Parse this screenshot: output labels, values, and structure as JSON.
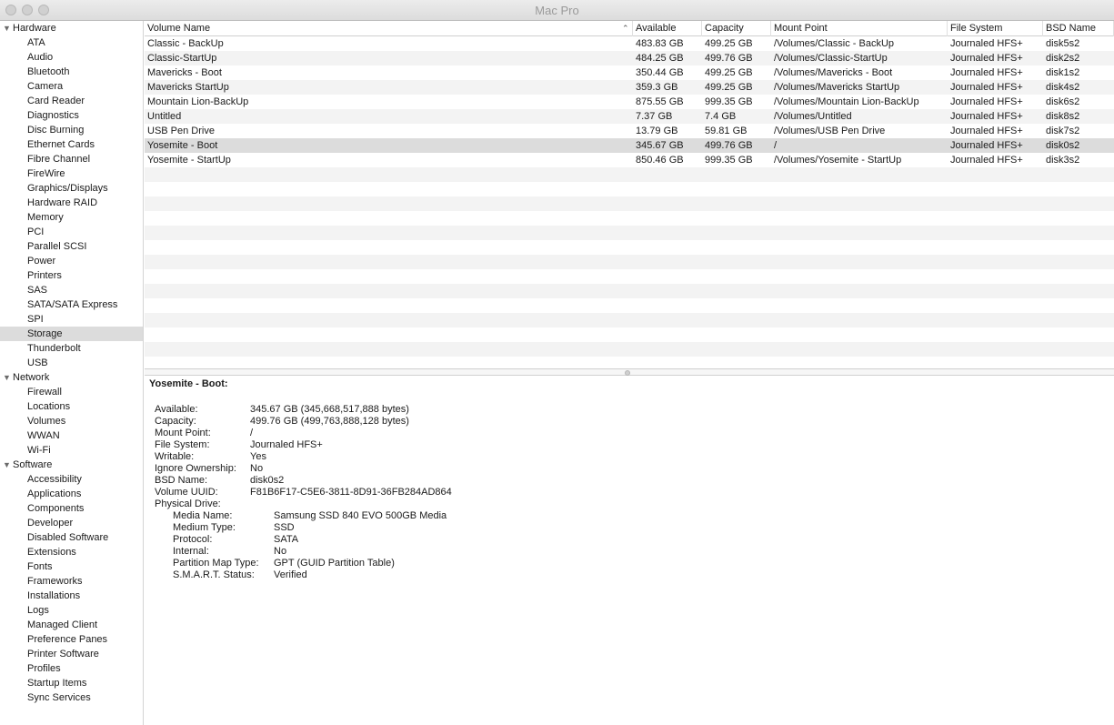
{
  "window": {
    "title": "Mac Pro"
  },
  "sidebar": {
    "groups": [
      {
        "label": "Hardware",
        "items": [
          "ATA",
          "Audio",
          "Bluetooth",
          "Camera",
          "Card Reader",
          "Diagnostics",
          "Disc Burning",
          "Ethernet Cards",
          "Fibre Channel",
          "FireWire",
          "Graphics/Displays",
          "Hardware RAID",
          "Memory",
          "PCI",
          "Parallel SCSI",
          "Power",
          "Printers",
          "SAS",
          "SATA/SATA Express",
          "SPI",
          "Storage",
          "Thunderbolt",
          "USB"
        ]
      },
      {
        "label": "Network",
        "items": [
          "Firewall",
          "Locations",
          "Volumes",
          "WWAN",
          "Wi-Fi"
        ]
      },
      {
        "label": "Software",
        "items": [
          "Accessibility",
          "Applications",
          "Components",
          "Developer",
          "Disabled Software",
          "Extensions",
          "Fonts",
          "Frameworks",
          "Installations",
          "Logs",
          "Managed Client",
          "Preference Panes",
          "Printer Software",
          "Profiles",
          "Startup Items",
          "Sync Services"
        ]
      }
    ],
    "selected": "Storage"
  },
  "table": {
    "columns": [
      "Volume Name",
      "Available",
      "Capacity",
      "Mount Point",
      "File System",
      "BSD Name"
    ],
    "rows": [
      [
        "Classic - BackUp",
        "483.83 GB",
        "499.25 GB",
        "/Volumes/Classic - BackUp",
        "Journaled HFS+",
        "disk5s2"
      ],
      [
        "Classic-StartUp",
        "484.25 GB",
        "499.76 GB",
        "/Volumes/Classic-StartUp",
        "Journaled HFS+",
        "disk2s2"
      ],
      [
        "Mavericks - Boot",
        "350.44 GB",
        "499.25 GB",
        "/Volumes/Mavericks - Boot",
        "Journaled HFS+",
        "disk1s2"
      ],
      [
        "Mavericks StartUp",
        "359.3 GB",
        "499.25 GB",
        "/Volumes/Mavericks StartUp",
        "Journaled HFS+",
        "disk4s2"
      ],
      [
        "Mountain Lion-BackUp",
        "875.55 GB",
        "999.35 GB",
        "/Volumes/Mountain Lion-BackUp",
        "Journaled HFS+",
        "disk6s2"
      ],
      [
        "Untitled",
        "7.37 GB",
        "7.4 GB",
        "/Volumes/Untitled",
        "Journaled HFS+",
        "disk8s2"
      ],
      [
        "USB Pen Drive",
        "13.79 GB",
        "59.81 GB",
        "/Volumes/USB Pen Drive",
        "Journaled HFS+",
        "disk7s2"
      ],
      [
        "Yosemite - Boot",
        "345.67 GB",
        "499.76 GB",
        "/",
        "Journaled HFS+",
        "disk0s2"
      ],
      [
        "Yosemite - StartUp",
        "850.46 GB",
        "999.35 GB",
        "/Volumes/Yosemite - StartUp",
        "Journaled HFS+",
        "disk3s2"
      ]
    ],
    "selected_row": 7,
    "sort_icon": "chevron-up-icon"
  },
  "detail": {
    "title": "Yosemite - Boot:",
    "fields": [
      {
        "k": "Available:",
        "v": "345.67 GB (345,668,517,888 bytes)"
      },
      {
        "k": "Capacity:",
        "v": "499.76 GB (499,763,888,128 bytes)"
      },
      {
        "k": "Mount Point:",
        "v": "/"
      },
      {
        "k": "File System:",
        "v": "Journaled HFS+"
      },
      {
        "k": "Writable:",
        "v": "Yes"
      },
      {
        "k": "Ignore Ownership:",
        "v": "No"
      },
      {
        "k": "BSD Name:",
        "v": "disk0s2"
      },
      {
        "k": "Volume UUID:",
        "v": "F81B6F17-C5E6-3811-8D91-36FB284AD864"
      }
    ],
    "physical_label": "Physical Drive:",
    "physical": [
      {
        "k": "Media Name:",
        "v": "Samsung SSD 840 EVO 500GB Media"
      },
      {
        "k": "Medium Type:",
        "v": "SSD"
      },
      {
        "k": "Protocol:",
        "v": "SATA"
      },
      {
        "k": "Internal:",
        "v": "No"
      },
      {
        "k": "Partition Map Type:",
        "v": "GPT (GUID Partition Table)"
      },
      {
        "k": "S.M.A.R.T. Status:",
        "v": "Verified"
      }
    ]
  }
}
